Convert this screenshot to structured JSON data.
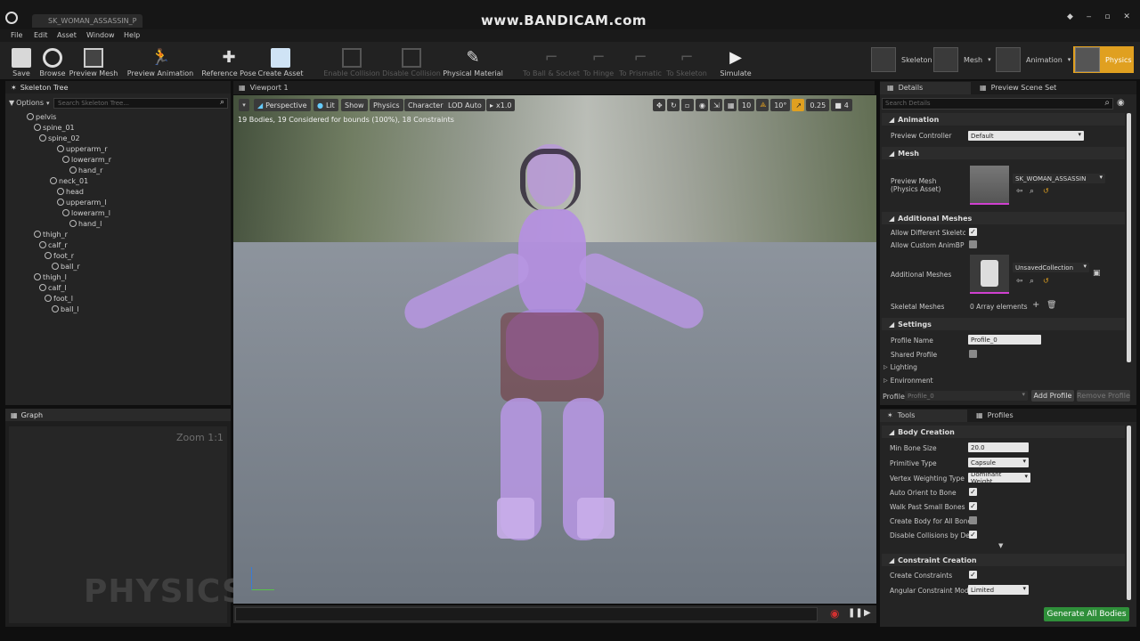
{
  "window": {
    "tab_title": "SK_WOMAN_ASSASSIN_P",
    "watermark": "www.BANDICAM.com"
  },
  "menu": [
    "File",
    "Edit",
    "Asset",
    "Window",
    "Help"
  ],
  "toolbar": {
    "save": "Save",
    "browse": "Browse",
    "preview_mesh": "Preview Mesh",
    "preview_animation": "Preview Animation",
    "reference_pose": "Reference Pose",
    "create_asset": "Create Asset",
    "enable_collision": "Enable Collision",
    "disable_collision": "Disable Collision",
    "physical_material": "Physical Material",
    "to_ball_socket": "To Ball & Socket",
    "to_hinge": "To Hinge",
    "to_prismatic": "To Prismatic",
    "to_skeleton": "To Skeleton",
    "simulate": "Simulate"
  },
  "modes": [
    "Skeleton",
    "Mesh",
    "Animation",
    "Physics"
  ],
  "skeleton_tree": {
    "title": "Skeleton Tree",
    "options": "Options",
    "search_placeholder": "Search Skeleton Tree...",
    "bones": [
      "pelvis",
      "spine_01",
      "spine_02",
      "upperarm_r",
      "lowerarm_r",
      "hand_r",
      "neck_01",
      "head",
      "upperarm_l",
      "lowerarm_l",
      "hand_l",
      "thigh_r",
      "calf_r",
      "foot_r",
      "ball_r",
      "thigh_l",
      "calf_l",
      "foot_l",
      "ball_l"
    ]
  },
  "graph": {
    "title": "Graph",
    "zoom": "Zoom 1:1",
    "watermark": "PHYSICS"
  },
  "viewport": {
    "title": "Viewport 1",
    "perspective": "Perspective",
    "lit": "Lit",
    "show": "Show",
    "physics": "Physics",
    "character": "Character",
    "lod": "LOD Auto",
    "speed": "x1.0",
    "stats": "19 Bodies, 19 Considered for bounds (100%), 18 Constraints",
    "grid": "10",
    "angle": "10°",
    "scale": "0.25",
    "cam": "4"
  },
  "details": {
    "tab": "Details",
    "tab2": "Preview Scene Set",
    "search_placeholder": "Search Details",
    "animation": "Animation",
    "preview_controller_label": "Preview Controller",
    "preview_controller": "Default",
    "mesh": "Mesh",
    "preview_mesh_label": "Preview Mesh",
    "preview_mesh_sub": "(Physics Asset)",
    "preview_mesh_value": "SK_WOMAN_ASSASSIN",
    "additional_meshes": "Additional Meshes",
    "allow_diff": "Allow Different Skeletons",
    "allow_custom": "Allow Custom AnimBP Ov",
    "additional_meshes_label": "Additional Meshes",
    "collection": "UnsavedCollection",
    "skeletal_meshes_label": "Skeletal Meshes",
    "array": "0 Array elements",
    "settings": "Settings",
    "profile_name_label": "Profile Name",
    "profile_name": "Profile_0",
    "shared_profile": "Shared Profile",
    "lighting": "Lighting",
    "environment": "Environment",
    "profile_label": "Profile",
    "profile_value": "Profile_0",
    "add_profile": "Add Profile",
    "remove_profile": "Remove Profile"
  },
  "tools": {
    "tab": "Tools",
    "tab2": "Profiles",
    "body_creation": "Body Creation",
    "min_bone_size_label": "Min Bone Size",
    "min_bone_size": "20.0",
    "primitive_type_label": "Primitive Type",
    "primitive_type": "Capsule",
    "vertex_weighting_label": "Vertex Weighting Type",
    "vertex_weighting": "Dominant Weight",
    "auto_orient": "Auto Orient to Bone",
    "walk_past": "Walk Past Small Bones",
    "create_body_all": "Create Body for All Bones",
    "disable_collisions": "Disable Collisions by Defa",
    "constraint_creation": "Constraint Creation",
    "create_constraints": "Create Constraints",
    "angular_mode_label": "Angular Constraint Mode",
    "angular_mode": "Limited",
    "generate": "Generate All Bodies"
  }
}
